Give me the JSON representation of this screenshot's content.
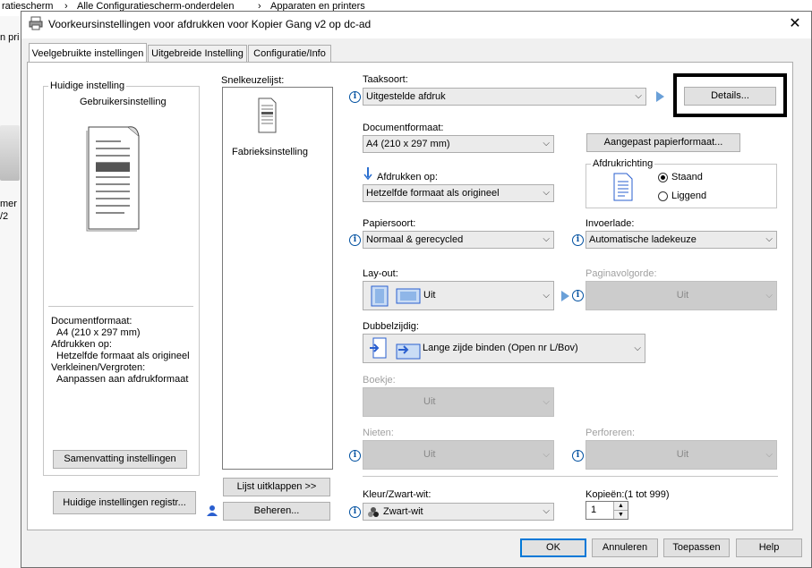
{
  "background": {
    "breadcrumb": {
      "item1": "ratiescherm",
      "sep1": "›",
      "item2": "Alle Configuratiescherm-onderdelen",
      "sep2": "›",
      "item3": "Apparaten en printers"
    },
    "side_text1": "n pri",
    "side_text2": "mer I",
    "side_text3": "/2"
  },
  "dialog": {
    "title": "Voorkeursinstellingen voor afdrukken voor Kopier Gang v2 op dc-ad",
    "close_label": "✕",
    "tabs": [
      "Veelgebruikte instellingen",
      "Uitgebreide Instelling",
      "Configuratie/Info"
    ],
    "left": {
      "group_label": "Huidige instelling",
      "setting_name": "Gebruikersinstelling",
      "summary_lines": [
        "Documentformaat:",
        "  A4 (210 x 297 mm)",
        "Afdrukken op:",
        "  Hetzelfde formaat als origineel",
        "Verkleinen/Vergroten:",
        "  Aanpassen aan afdrukformaat"
      ],
      "summary_button": "Samenvatting instellingen",
      "register_button": "Huidige instellingen registr..."
    },
    "quicklist": {
      "label": "Snelkeuzelijst:",
      "item": "Fabrieksinstelling",
      "expand_button": "Lijst uitklappen >>",
      "manage_button": "Beheren..."
    },
    "taaksoort": {
      "label": "Taaksoort:",
      "value": "Uitgestelde afdruk",
      "details_button": "Details..."
    },
    "documentformaat": {
      "label": "Documentformaat:",
      "value": "A4 (210 x 297 mm)",
      "custom_button": "Aangepast papierformaat..."
    },
    "afdrukken_op": {
      "label": "Afdrukken op:",
      "value": "Hetzelfde formaat als origineel"
    },
    "afdrukrichting": {
      "label": "Afdrukrichting",
      "option1": "Staand",
      "option2": "Liggend",
      "selected": "Staand"
    },
    "papiersoort": {
      "label": "Papiersoort:",
      "value": "Normaal & gerecycled"
    },
    "invoerlade": {
      "label": "Invoerlade:",
      "value": "Automatische ladekeuze"
    },
    "layout": {
      "label": "Lay-out:",
      "value": "Uit"
    },
    "paginavolgorde": {
      "label": "Paginavolgorde:",
      "value": "Uit"
    },
    "dubbelzijdig": {
      "label": "Dubbelzijdig:",
      "value": "Lange zijde binden (Open nr L/Bov)"
    },
    "boekje": {
      "label": "Boekje:",
      "value": "Uit"
    },
    "nieten": {
      "label": "Nieten:",
      "value": "Uit"
    },
    "perforeren": {
      "label": "Perforeren:",
      "value": "Uit"
    },
    "kleur": {
      "label": "Kleur/Zwart-wit:",
      "value": "Zwart-wit"
    },
    "kopieen": {
      "label": "Kopieën:(1 tot 999)",
      "value": "1"
    },
    "buttons": {
      "ok": "OK",
      "cancel": "Annuleren",
      "apply": "Toepassen",
      "help": "Help"
    },
    "icons": {
      "info": "i",
      "arrow": "▶",
      "combo_arrow": "⌵"
    },
    "colors": {
      "accent": "#0078d7",
      "highlight_box": "#000000"
    }
  }
}
